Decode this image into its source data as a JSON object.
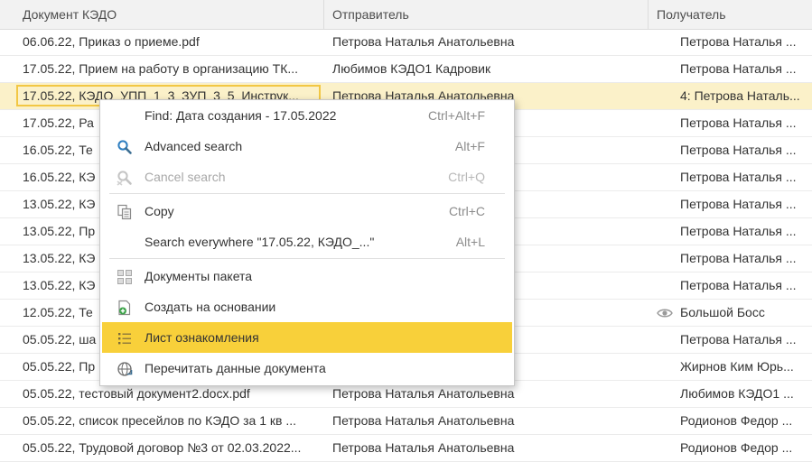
{
  "columns": {
    "doc": "Документ КЭДО",
    "sender": "Отправитель",
    "recipient": "Получатель"
  },
  "rows": [
    {
      "doc": "06.06.22, Приказ о приеме.pdf",
      "sender": "Петрова Наталья Анатольевна",
      "recipient": "Петрова Наталья ..."
    },
    {
      "doc": "17.05.22, Прием на работу в организацию ТК...",
      "sender": "Любимов КЭДО1 Кадровик",
      "recipient": "Петрова Наталья ..."
    },
    {
      "doc": "17.05.22, КЭДО_УПП_1_3_ЗУП_3_5_Инструк...",
      "sender": "Петрова Наталья Анатольевна",
      "recipient": "4: Петрова Наталь..."
    },
    {
      "doc": "17.05.22, Ра",
      "sender": "",
      "recipient": "Петрова Наталья ..."
    },
    {
      "doc": "16.05.22, Те",
      "sender": "",
      "recipient": "Петрова Наталья ..."
    },
    {
      "doc": "16.05.22, КЭ",
      "sender": "",
      "recipient": "Петрова Наталья ..."
    },
    {
      "doc": "13.05.22, КЭ",
      "sender": "",
      "recipient": "Петрова Наталья ..."
    },
    {
      "doc": "13.05.22, Пр",
      "sender": "",
      "recipient": "Петрова Наталья ..."
    },
    {
      "doc": "13.05.22, КЭ",
      "sender": "",
      "recipient": "Петрова Наталья ..."
    },
    {
      "doc": "13.05.22, КЭ",
      "sender": "",
      "recipient": "Петрова Наталья ..."
    },
    {
      "doc": "12.05.22, Те",
      "sender": "",
      "recipient": "Большой Босс"
    },
    {
      "doc": "05.05.22, ша",
      "sender": "",
      "recipient": "Петрова Наталья ..."
    },
    {
      "doc": "05.05.22, Пр",
      "sender": "",
      "recipient": "Жирнов Ким Юрь..."
    },
    {
      "doc": "05.05.22, тестовый документ2.docx.pdf",
      "sender": "Петрова Наталья Анатольевна",
      "recipient": "Любимов КЭДО1 ..."
    },
    {
      "doc": "05.05.22, список пресейлов по КЭДО за 1 кв ...",
      "sender": "Петрова Наталья Анатольевна",
      "recipient": "Родионов Федор ..."
    },
    {
      "doc": "05.05.22, Трудовой договор №3 от 02.03.2022...",
      "sender": "Петрова Наталья Анатольевна",
      "recipient": "Родионов Федор ..."
    }
  ],
  "selected_row_index": 2,
  "viewed_icon": "eye-icon",
  "context_menu": {
    "find": {
      "label": "Find: Дата создания - 17.05.2022",
      "shortcut": "Ctrl+Alt+F"
    },
    "advanced_search": {
      "label": "Advanced search",
      "shortcut": "Alt+F",
      "icon": "magnifier-icon"
    },
    "cancel_search": {
      "label": "Cancel search",
      "shortcut": "Ctrl+Q",
      "icon": "cancel-search-icon",
      "disabled": true
    },
    "copy": {
      "label": "Copy",
      "shortcut": "Ctrl+C",
      "icon": "copy-icon"
    },
    "search_everywhere": {
      "label": "Search everywhere \"17.05.22, КЭДО_...\"",
      "shortcut": "Alt+L"
    },
    "package_docs": {
      "label": "Документы пакета",
      "icon": "grid-icon"
    },
    "create_based_on": {
      "label": "Создать на основании",
      "icon": "create-based-icon"
    },
    "ack_sheet": {
      "label": "Лист ознакомления",
      "icon": "list-icon",
      "highlighted": true
    },
    "reread": {
      "label": "Перечитать данные документа",
      "icon": "refresh-globe-icon"
    }
  },
  "colors": {
    "selected_row": "#fbf1c9",
    "focus_border": "#f2c744",
    "menu_highlight": "#f8d03a",
    "header_bg": "#f2f2f2"
  }
}
